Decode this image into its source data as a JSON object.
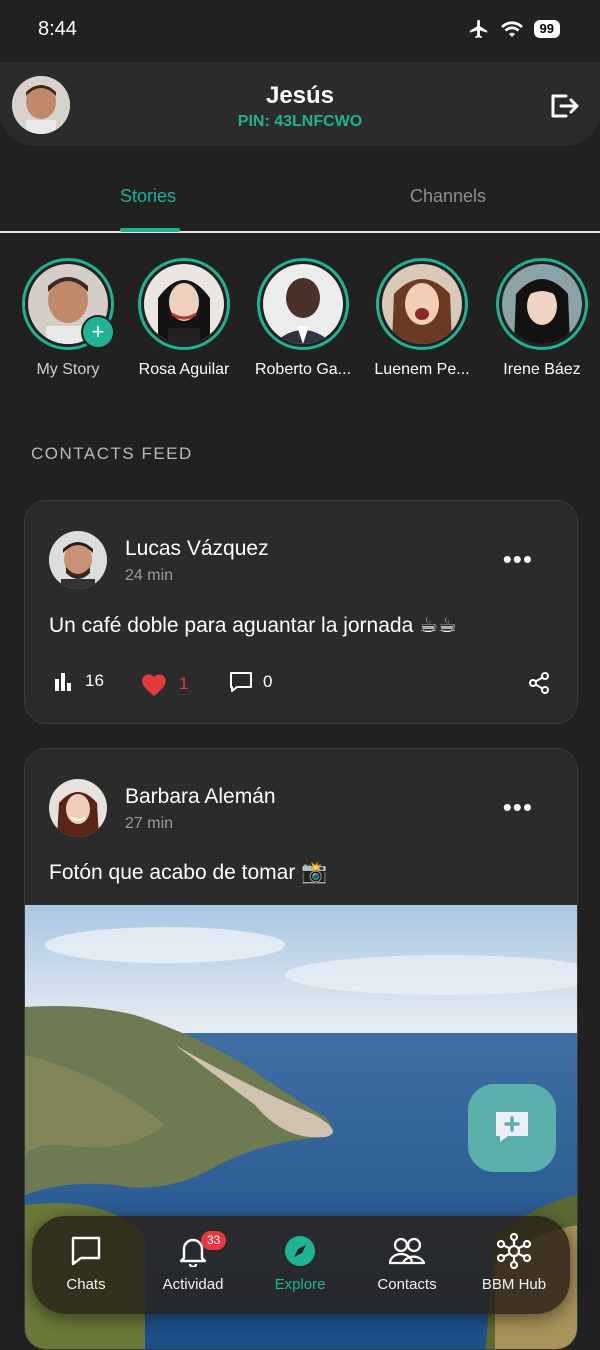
{
  "status_bar": {
    "time": "8:44",
    "battery": "99"
  },
  "header": {
    "name": "Jesús",
    "pin": "PIN: 43LNFCWO"
  },
  "tabs": [
    {
      "label": "Stories"
    },
    {
      "label": "Channels"
    }
  ],
  "stories": [
    {
      "name": "My Story"
    },
    {
      "name": "Rosa Aguilar"
    },
    {
      "name": "Roberto Ga..."
    },
    {
      "name": "Luenem Pe..."
    },
    {
      "name": "Irene Báez"
    }
  ],
  "feed_label": "CONTACTS FEED",
  "posts": [
    {
      "author": "Lucas Vázquez",
      "time": "24 min",
      "text": "Un café doble para aguantar la jornada ☕☕",
      "views": "16",
      "likes": "1",
      "comments": "0"
    },
    {
      "author": "Barbara Alemán",
      "time": "27 min",
      "text": "Fotón que acabo de tomar 📸"
    }
  ],
  "bottom_nav": [
    {
      "label": "Chats"
    },
    {
      "label": "Actividad",
      "badge": "33"
    },
    {
      "label": "Explore"
    },
    {
      "label": "Contacts"
    },
    {
      "label": "BBM Hub"
    }
  ],
  "colors": {
    "accent": "#1db393",
    "background": "#212121",
    "card": "#2b2b2b",
    "like": "#e5393e"
  }
}
